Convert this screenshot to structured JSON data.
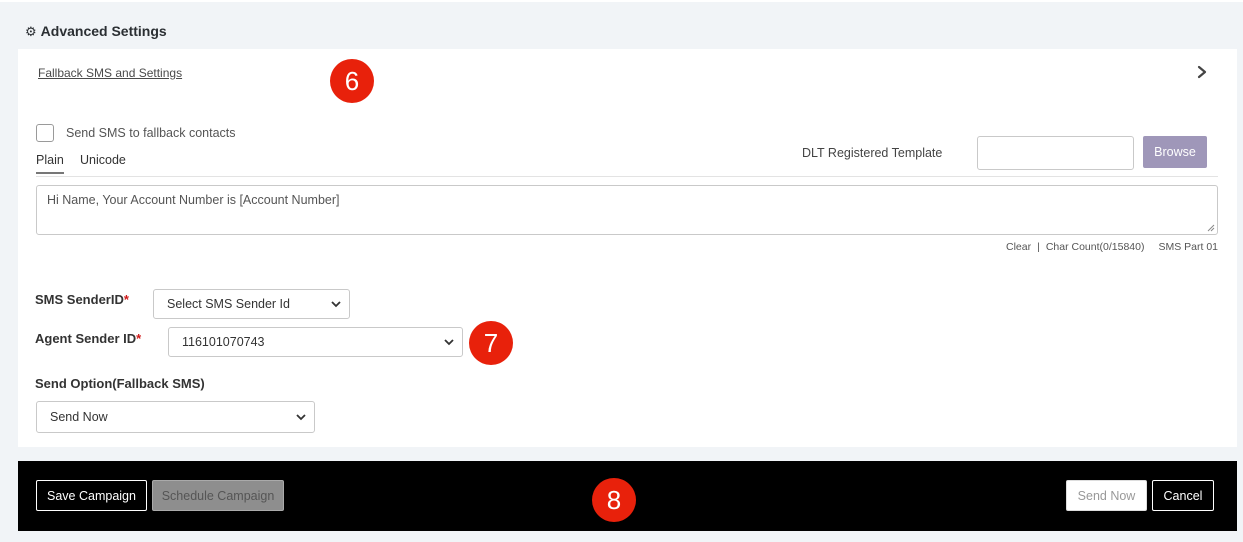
{
  "advanced_settings": {
    "icon": "gear-icon",
    "title": "Advanced Settings"
  },
  "fallback": {
    "link_label": "Fallback SMS and Settings",
    "expand_icon": "chevron-right-icon",
    "checkbox_label": "Send SMS to fallback contacts",
    "checked": false,
    "tabs": [
      {
        "label": "Plain",
        "active": true
      },
      {
        "label": "Unicode",
        "active": false
      }
    ],
    "dlt_label": "DLT Registered Template",
    "dlt_value": "",
    "browse_label": "Browse",
    "message": "Hi Name, Your Account Number is [Account Number]",
    "clear_label": "Clear",
    "separator": "|",
    "char_count": "Char Count(0/15840)",
    "sms_part": "SMS Part 01"
  },
  "fields": {
    "sms_sender_label": "SMS SenderID",
    "sms_sender_value": "Select SMS Sender Id",
    "agent_sender_label": "Agent Sender ID",
    "agent_sender_value": "116101070743",
    "required_mark": "*",
    "send_option_label": "Send Option(Fallback SMS)",
    "send_option_value": "Send Now"
  },
  "footer": {
    "save_label": "Save Campaign",
    "schedule_label": "Schedule Campaign",
    "send_now_label": "Send Now",
    "cancel_label": "Cancel"
  },
  "badges": [
    "6",
    "7",
    "8"
  ],
  "colors": {
    "badge": "#e8210b",
    "browse_button": "#9f97b9",
    "footer_bg": "#000000",
    "required": "#d01818"
  }
}
